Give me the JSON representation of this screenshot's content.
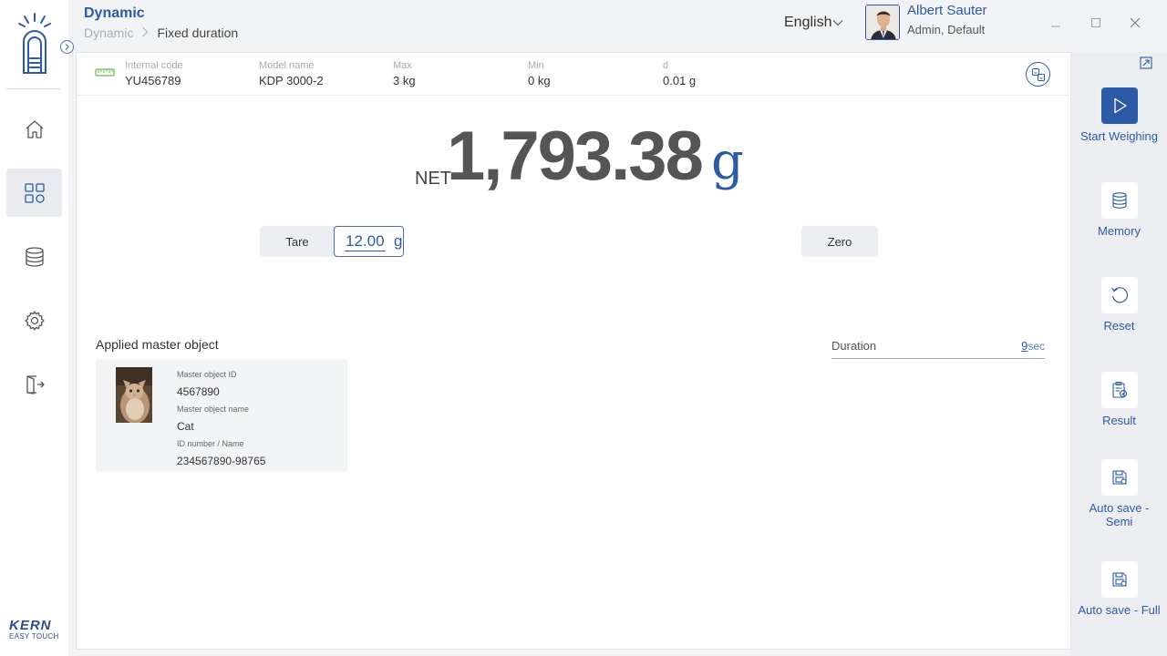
{
  "header": {
    "title": "Dynamic",
    "breadcrumb_parent": "Dynamic",
    "breadcrumb_current": "Fixed duration",
    "language": "English",
    "user_name": "Albert Sauter",
    "user_role": "Admin, Default"
  },
  "sidebar": {
    "items": [
      {
        "name": "home",
        "icon": "home-icon"
      },
      {
        "name": "apps",
        "icon": "apps-grid-icon",
        "active": true
      },
      {
        "name": "database",
        "icon": "database-icon"
      },
      {
        "name": "settings",
        "icon": "gear-icon"
      },
      {
        "name": "logout",
        "icon": "logout-icon"
      }
    ],
    "brand": "KERN",
    "brand_sub": "EASY TOUCH"
  },
  "info_bar": {
    "internal_code_label": "Internal code",
    "internal_code": "YU456789",
    "model_name_label": "Model name",
    "model_name": "KDP 3000-2",
    "max_label": "Max",
    "max": "3 kg",
    "min_label": "Min",
    "min": "0 kg",
    "d_label": "d",
    "d": "0.01 g"
  },
  "weight": {
    "mode": "NET",
    "value": "1,793.38",
    "unit": "g"
  },
  "tare": {
    "label": "Tare",
    "value": "12.00",
    "unit": "g"
  },
  "zero": {
    "label": "Zero"
  },
  "master_object": {
    "title": "Applied master object",
    "id_label": "Master object ID",
    "id": "4567890",
    "name_label": "Master object name",
    "name": "Cat",
    "idnum_label": "ID number / Name",
    "idnum": "234567890-98765"
  },
  "duration": {
    "label": "Duration",
    "value": "9",
    "unit": "sec"
  },
  "actions": {
    "start": "Start Weighing",
    "memory": "Memory",
    "reset": "Reset",
    "result": "Result",
    "auto_semi": "Auto save - Semi",
    "auto_full": "Auto save - Full"
  },
  "colors": {
    "accent": "#2d5aa6",
    "background": "#f2f3f5"
  }
}
